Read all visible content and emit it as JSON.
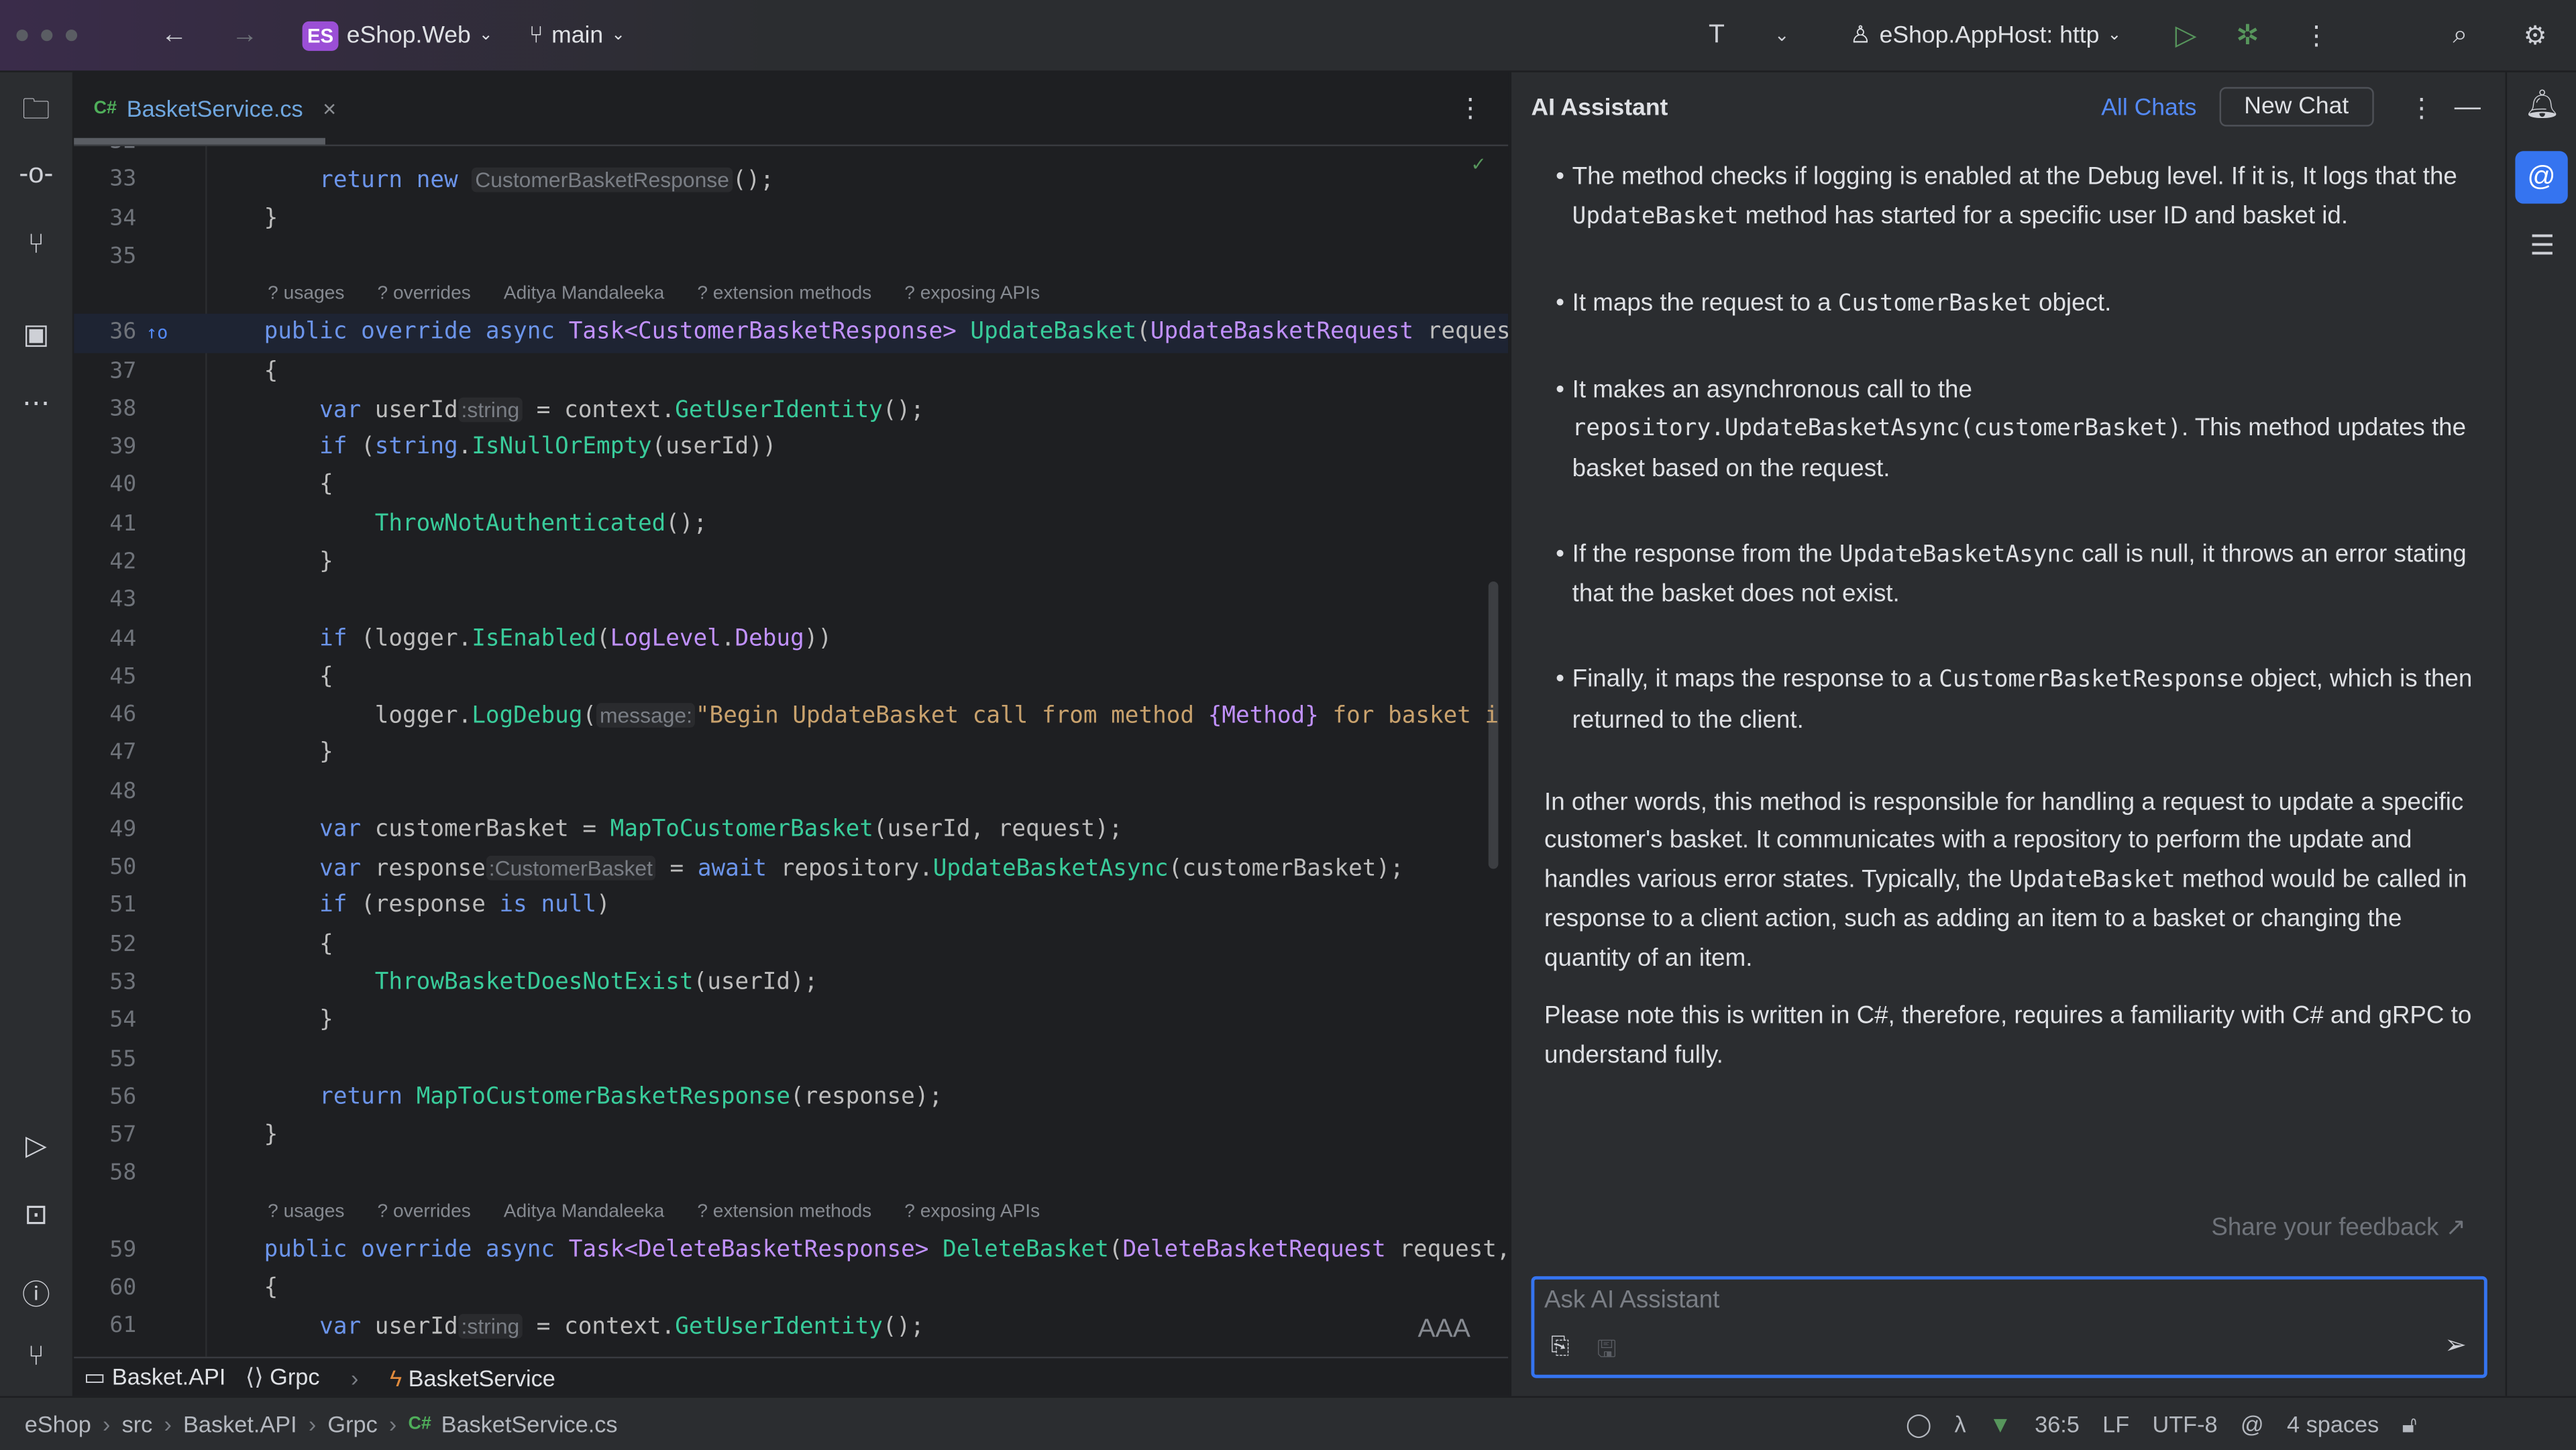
{
  "topbar": {
    "project_badge": "ES",
    "project": "eShop.Web",
    "branch": "main",
    "run_config": "eShop.AppHost: http"
  },
  "editor": {
    "tab": {
      "lang": "C#",
      "file": "BasketService.cs"
    },
    "inlay": [
      "? usages",
      "? overrides",
      "Aditya Mandaleeka",
      "? extension methods",
      "? exposing APIs"
    ],
    "lines": [
      {
        "n": "32",
        "c": []
      },
      {
        "n": "33",
        "c": [
          [
            "p",
            "        "
          ],
          [
            "k",
            "return"
          ],
          [
            "p",
            " "
          ],
          [
            "k",
            "new"
          ],
          [
            "p",
            " "
          ],
          [
            "h",
            "CustomerBasketResponse"
          ],
          [
            "p",
            "();"
          ]
        ]
      },
      {
        "n": "34",
        "c": [
          [
            "p",
            "    }"
          ]
        ]
      },
      {
        "n": "35",
        "c": []
      },
      {
        "inlay": true
      },
      {
        "n": "36",
        "hl": true,
        "c": [
          [
            "p",
            "    "
          ],
          [
            "k",
            "public override async"
          ],
          [
            "p",
            " "
          ],
          [
            "t",
            "Task<CustomerBasketResponse>"
          ],
          [
            "p",
            " "
          ],
          [
            "m",
            "UpdateBasket"
          ],
          [
            "p",
            "("
          ],
          [
            "t",
            "UpdateBasketRequest"
          ],
          [
            "p",
            " reques"
          ]
        ]
      },
      {
        "n": "37",
        "c": [
          [
            "p",
            "    {"
          ]
        ]
      },
      {
        "n": "38",
        "c": [
          [
            "p",
            "        "
          ],
          [
            "k",
            "var"
          ],
          [
            "p",
            " userId"
          ],
          [
            "h",
            ":string"
          ],
          [
            "p",
            " = context."
          ],
          [
            "m",
            "GetUserIdentity"
          ],
          [
            "p",
            "();"
          ]
        ]
      },
      {
        "n": "39",
        "c": [
          [
            "p",
            "        "
          ],
          [
            "k",
            "if"
          ],
          [
            "p",
            " ("
          ],
          [
            "k",
            "string"
          ],
          [
            "p",
            "."
          ],
          [
            "m",
            "IsNullOrEmpty"
          ],
          [
            "p",
            "(userId))"
          ]
        ]
      },
      {
        "n": "40",
        "c": [
          [
            "p",
            "        {"
          ]
        ]
      },
      {
        "n": "41",
        "c": [
          [
            "p",
            "            "
          ],
          [
            "m",
            "ThrowNotAuthenticated"
          ],
          [
            "p",
            "();"
          ]
        ]
      },
      {
        "n": "42",
        "c": [
          [
            "p",
            "        }"
          ]
        ]
      },
      {
        "n": "43",
        "c": []
      },
      {
        "n": "44",
        "c": [
          [
            "p",
            "        "
          ],
          [
            "k",
            "if"
          ],
          [
            "p",
            " (logger."
          ],
          [
            "m",
            "IsEnabled"
          ],
          [
            "p",
            "("
          ],
          [
            "t",
            "LogLevel"
          ],
          [
            "p",
            "."
          ],
          [
            "e",
            "Debug"
          ],
          [
            "p",
            "))"
          ]
        ]
      },
      {
        "n": "45",
        "c": [
          [
            "p",
            "        {"
          ]
        ]
      },
      {
        "n": "46",
        "c": [
          [
            "p",
            "            logger."
          ],
          [
            "m",
            "LogDebug"
          ],
          [
            "p",
            "("
          ],
          [
            "h",
            "message:"
          ],
          [
            "s",
            "\"Begin UpdateBasket call from method "
          ],
          [
            "e",
            "{Method}"
          ],
          [
            "s",
            " for basket i"
          ]
        ]
      },
      {
        "n": "47",
        "c": [
          [
            "p",
            "        }"
          ]
        ]
      },
      {
        "n": "48",
        "c": []
      },
      {
        "n": "49",
        "c": [
          [
            "p",
            "        "
          ],
          [
            "k",
            "var"
          ],
          [
            "p",
            " customerBasket = "
          ],
          [
            "m",
            "MapToCustomerBasket"
          ],
          [
            "p",
            "(userId, request);"
          ]
        ]
      },
      {
        "n": "50",
        "c": [
          [
            "p",
            "        "
          ],
          [
            "k",
            "var"
          ],
          [
            "p",
            " response"
          ],
          [
            "h",
            ":CustomerBasket"
          ],
          [
            "p",
            " = "
          ],
          [
            "k",
            "await"
          ],
          [
            "p",
            " repository."
          ],
          [
            "m",
            "UpdateBasketAsync"
          ],
          [
            "p",
            "(customerBasket);"
          ]
        ]
      },
      {
        "n": "51",
        "c": [
          [
            "p",
            "        "
          ],
          [
            "k",
            "if"
          ],
          [
            "p",
            " (response "
          ],
          [
            "k",
            "is null"
          ],
          [
            "p",
            ")"
          ]
        ]
      },
      {
        "n": "52",
        "c": [
          [
            "p",
            "        {"
          ]
        ]
      },
      {
        "n": "53",
        "c": [
          [
            "p",
            "            "
          ],
          [
            "m",
            "ThrowBasketDoesNotExist"
          ],
          [
            "p",
            "(userId);"
          ]
        ]
      },
      {
        "n": "54",
        "c": [
          [
            "p",
            "        }"
          ]
        ]
      },
      {
        "n": "55",
        "c": []
      },
      {
        "n": "56",
        "c": [
          [
            "p",
            "        "
          ],
          [
            "k",
            "return"
          ],
          [
            "p",
            " "
          ],
          [
            "m",
            "MapToCustomerBasketResponse"
          ],
          [
            "p",
            "(response);"
          ]
        ]
      },
      {
        "n": "57",
        "c": [
          [
            "p",
            "    }"
          ]
        ]
      },
      {
        "n": "58",
        "c": []
      },
      {
        "inlay": true
      },
      {
        "n": "59",
        "c": [
          [
            "p",
            "    "
          ],
          [
            "k",
            "public override async"
          ],
          [
            "p",
            " "
          ],
          [
            "t",
            "Task<DeleteBasketResponse>"
          ],
          [
            "p",
            " "
          ],
          [
            "m",
            "DeleteBasket"
          ],
          [
            "p",
            "("
          ],
          [
            "t",
            "DeleteBasketRequest"
          ],
          [
            "p",
            " request,"
          ]
        ]
      },
      {
        "n": "60",
        "c": [
          [
            "p",
            "    {"
          ]
        ]
      },
      {
        "n": "61",
        "c": [
          [
            "p",
            "        "
          ],
          [
            "k",
            "var"
          ],
          [
            "p",
            " userId"
          ],
          [
            "h",
            ":string"
          ],
          [
            "p",
            " = context."
          ],
          [
            "m",
            "GetUserIdentity"
          ],
          [
            "p",
            "();"
          ]
        ]
      }
    ],
    "reader_mode": "AAA",
    "crumbs": [
      "Basket.API",
      "Grpc",
      "BasketService"
    ]
  },
  "ai": {
    "title": "AI Assistant",
    "all_chats": "All Chats",
    "new_chat": "New Chat",
    "bullets": [
      [
        [
          "t",
          "The method checks if logging is enabled at the Debug level. If it is, It logs that the "
        ],
        [
          "c",
          "UpdateBasket"
        ],
        [
          "t",
          " method has started for a specific user ID and basket id."
        ]
      ],
      [
        [
          "t",
          "It maps the request to a "
        ],
        [
          "c",
          "CustomerBasket"
        ],
        [
          "t",
          " object."
        ]
      ],
      [
        [
          "t",
          "It makes an asynchronous call to the "
        ],
        [
          "c",
          "repository.UpdateBasketAsync(customerBasket)"
        ],
        [
          "t",
          ". This method updates the basket based on the request."
        ]
      ],
      [
        [
          "t",
          "If the response from the "
        ],
        [
          "c",
          "UpdateBasketAsync"
        ],
        [
          "t",
          " call is null, it throws an error stating that the basket does not exist."
        ]
      ],
      [
        [
          "t",
          "Finally, it maps the response to a "
        ],
        [
          "c",
          "CustomerBasketResponse"
        ],
        [
          "t",
          " object, which is then returned to the client."
        ]
      ]
    ],
    "para1": [
      [
        "t",
        "In other words, this method is responsible for handling a request to update a specific customer's basket. It communicates with a repository to perform the update and handles various error states. Typically, the "
      ],
      [
        "c",
        "UpdateBasket"
      ],
      [
        "t",
        " method would be called in response to a client action, such as adding an item to a basket or changing the quantity of an item."
      ]
    ],
    "para2": "Please note this is written in C#, therefore, requires a familiarity with C# and gRPC to understand fully.",
    "feedback": "Share your feedback ↗",
    "input_placeholder": "Ask AI Assistant"
  },
  "status": {
    "path": [
      "eShop",
      "src",
      "Basket.API",
      "Grpc"
    ],
    "file_lang": "C#",
    "file": "BasketService.cs",
    "position": "36:5",
    "line_ending": "LF",
    "encoding": "UTF-8",
    "indent": "4 spaces"
  },
  "colors": {
    "accent": "#3574f0",
    "keyword": "#6c95eb",
    "method": "#39cc9b",
    "type": "#c191ff",
    "string": "#c9a26d"
  }
}
